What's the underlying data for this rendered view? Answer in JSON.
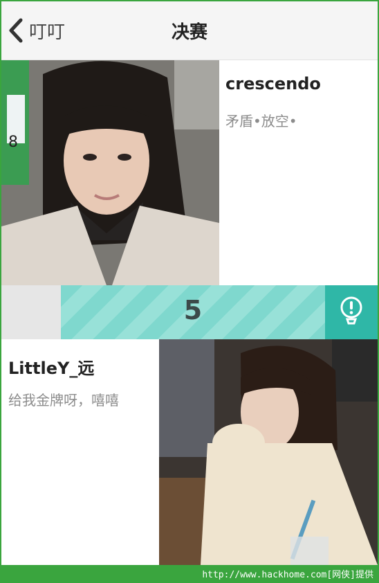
{
  "header": {
    "back_label": "叮叮",
    "title": "决赛"
  },
  "entries": [
    {
      "name": "crescendo",
      "motto": "矛盾•放空•"
    },
    {
      "name": "LittleY_远",
      "motto": "给我金牌呀，嘻嘻"
    }
  ],
  "vote": {
    "count": "5"
  },
  "footer": {
    "text": "http://www.hackhome.com[网侠]提供"
  },
  "colors": {
    "accent": "#2fb7a7",
    "stripe": "#7fd8ce",
    "footer_green": "#3aa53e"
  },
  "icons": {
    "back": "chevron-left-icon",
    "tip": "lightbulb-exclamation-icon"
  }
}
